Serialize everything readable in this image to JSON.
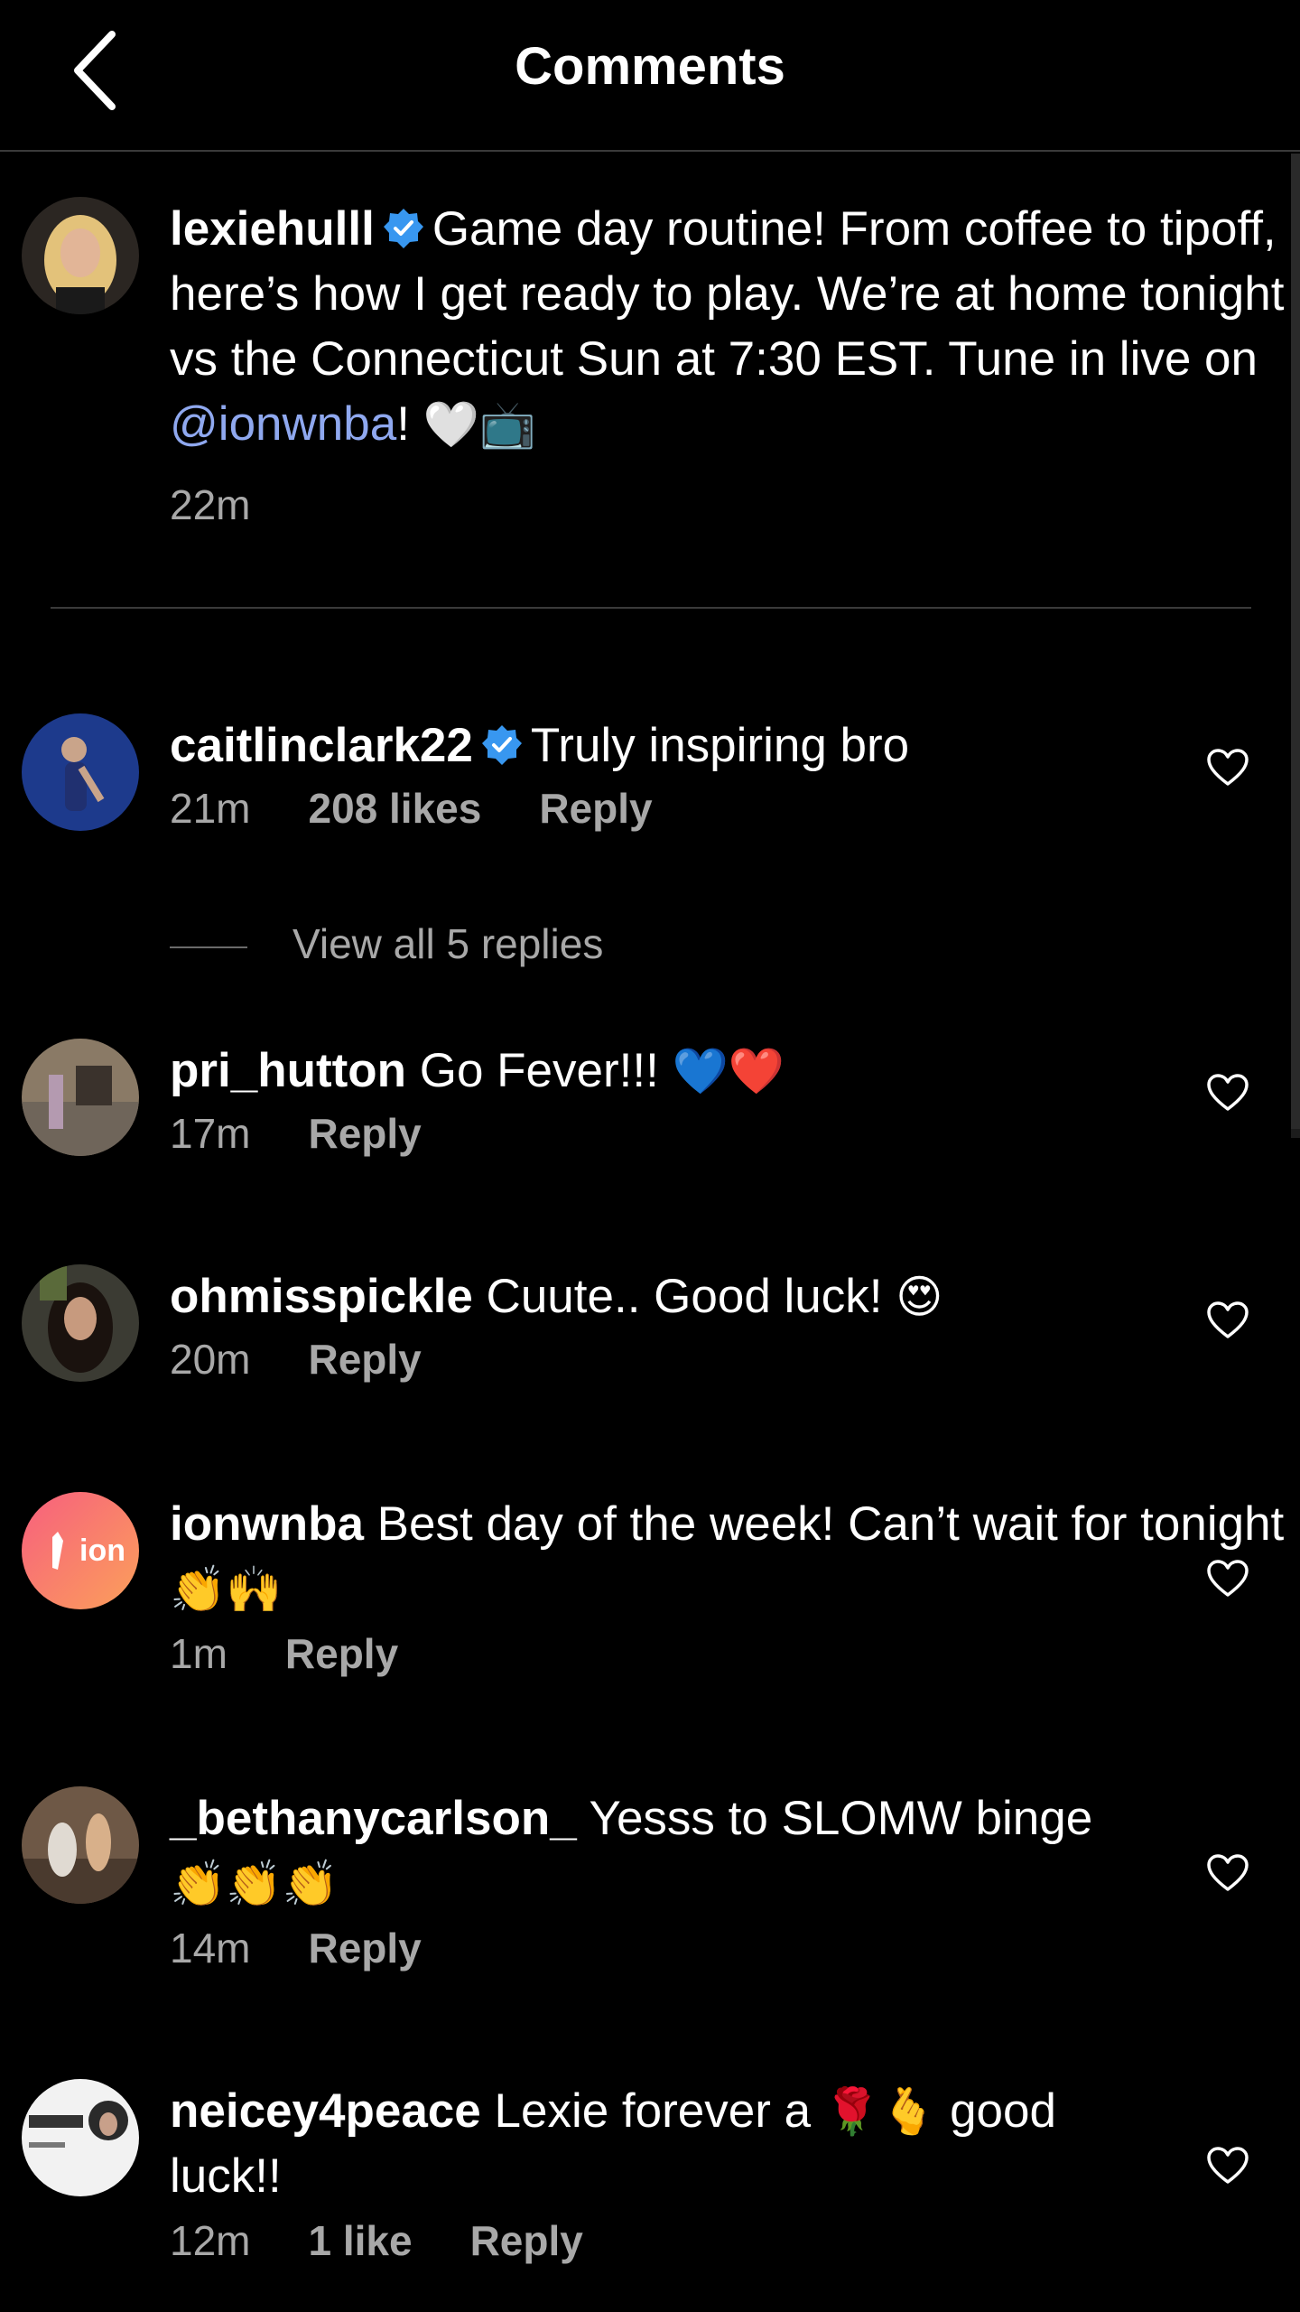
{
  "header": {
    "title": "Comments"
  },
  "caption": {
    "username": "lexiehulll",
    "text_before_mention": "Game day routine! From coffee to tipoff, here’s how I get ready to play. We’re at home tonight vs the Connecticut Sun at 7:30 EST. Tune in live on ",
    "mention": "@ionwnba",
    "text_after_mention": "!",
    "emoji": "🤍📺",
    "time": "22m"
  },
  "comments": [
    {
      "username": "caitlinclark22",
      "text": "Truly inspiring bro",
      "emoji": "",
      "time": "21m",
      "likes": "208 likes",
      "reply": "Reply"
    },
    {
      "username": "pri_hutton",
      "text": "Go Fever!!!",
      "emoji": "💙❤️",
      "time": "17m",
      "likes": "",
      "reply": "Reply"
    },
    {
      "username": "ohmisspickle",
      "text": "Cuute.. Good luck!",
      "emoji": "😍",
      "time": "20m",
      "likes": "",
      "reply": "Reply"
    },
    {
      "username": "ionwnba",
      "text": "Best day of the week! Can’t wait for tonight",
      "emoji": "👏🙌",
      "time": "1m",
      "likes": "",
      "reply": "Reply"
    },
    {
      "username": "_bethanycarlson_",
      "text": "Yesss to SLOMW binge",
      "emoji": "👏👏👏",
      "time": "14m",
      "likes": "",
      "reply": "Reply"
    },
    {
      "username": "neicey4peace",
      "text": "Lexie forever a",
      "emoji": "🌹🫰",
      "text_after": "good luck!!",
      "time": "12m",
      "likes": "1 like",
      "reply": "Reply"
    }
  ],
  "view_replies": "View all 5 replies",
  "avatars": {
    "ionwnba_text": "ion"
  },
  "colors": {
    "background": "#000000",
    "muted": "#a8a8a8",
    "mention": "#8fa8ef",
    "verified": "#3897f0",
    "divider": "#3a3a3a"
  }
}
